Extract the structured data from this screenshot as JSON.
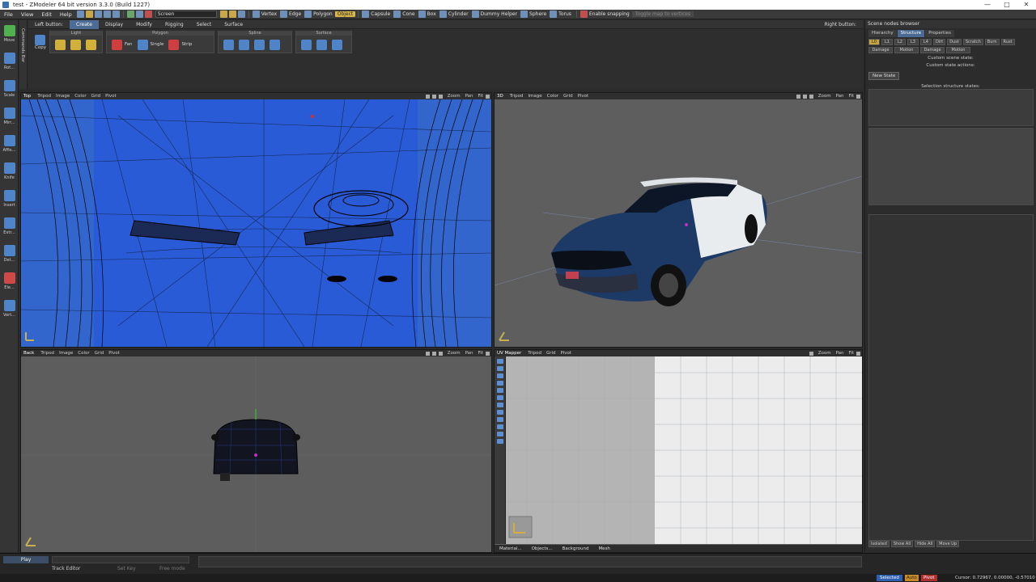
{
  "window": {
    "title": "test - ZModeler 64 bit version 3.3.0 (Build 1227)",
    "controls": [
      "—",
      "□",
      "✕"
    ]
  },
  "menu": {
    "items": [
      "File",
      "View",
      "Edit",
      "Help"
    ],
    "screen_select": "Screen",
    "modes": [
      "Vertex",
      "Edge",
      "Polygon",
      "Object"
    ],
    "active_mode": "Object",
    "primitives": [
      "Capsule",
      "Cone",
      "Box",
      "Cylinder",
      "Dummy Helper",
      "Sphere",
      "Torus"
    ],
    "snapping": "Enable snapping",
    "toggle_map": "Toggle map to vertices"
  },
  "left_tools": [
    {
      "label": "Move",
      "icon": "move-icon"
    },
    {
      "label": "Rot...",
      "icon": "rotate-icon"
    },
    {
      "label": "Scale",
      "icon": "scale-icon"
    },
    {
      "label": "Mirr...",
      "icon": "mirror-icon"
    },
    {
      "label": "Affix...",
      "icon": "affix-icon"
    },
    {
      "label": "Knife",
      "icon": "knife-icon"
    },
    {
      "label": "Insert",
      "icon": "insert-icon"
    },
    {
      "label": "Extr...",
      "icon": "extrude-icon"
    },
    {
      "label": "Det...",
      "icon": "detach-icon"
    },
    {
      "label": "Ele...",
      "icon": "element-icon"
    },
    {
      "label": "Vert...",
      "icon": "vertex-icon"
    }
  ],
  "commands_bar": "Commands Bar",
  "ribbon": {
    "left_button": "Left button:",
    "tabs": [
      "Create",
      "Display",
      "Modify",
      "Rigging",
      "Select",
      "Surface"
    ],
    "active_tab": "Create",
    "copy": "Copy",
    "group_light": "Light",
    "group_polygon": "Polygon",
    "group_spline": "Spline",
    "group_surface": "Surface",
    "polygon_buttons": [
      "Fan",
      "Single",
      "Strip"
    ],
    "right_button": "Right button:"
  },
  "viewports": {
    "menu": [
      "Tripod",
      "Image",
      "Color",
      "Grid",
      "Pivot"
    ],
    "controls": [
      "Zoom",
      "Pan",
      "Fit"
    ],
    "top": {
      "name": "Top"
    },
    "persp": {
      "name": "3D"
    },
    "back": {
      "name": "Back"
    },
    "uv": {
      "name": "UV Mapper",
      "menu": [
        "Tripod",
        "Grid",
        "Pivot"
      ],
      "footer": [
        "Material...",
        "Objects...",
        "Background",
        "Mesh"
      ]
    }
  },
  "right_panel": {
    "title": "Scene nodes browser",
    "tabs": [
      "Hierarchy",
      "Structure",
      "Properties"
    ],
    "active_tab": "Structure",
    "lod_chips": [
      "L0",
      "L1",
      "L2",
      "L3",
      "L4",
      "Dirt",
      "Dust",
      "Scratch",
      "Burn",
      "Rust"
    ],
    "dropdowns": [
      "Damage",
      "Motion",
      "Damage",
      "Motion"
    ],
    "custom_scene_state": "Custom scene state:",
    "custom_state_actions": "Custom state actions:",
    "new_state": "New State",
    "selection_structure": "Selection structure states:",
    "bottom_buttons": [
      "Isolated",
      "Show All",
      "Hide All",
      "Move Up"
    ]
  },
  "timeline": {
    "play": "Play",
    "track_editor": "Track Editor",
    "set_key": "Set Key",
    "free_mode": "Free mode"
  },
  "status": {
    "selected": "Selected",
    "auto": "Auto",
    "pivot": "Pivot",
    "cursor": "Cursor: 0.72967, 0.00000, -0.57010"
  }
}
